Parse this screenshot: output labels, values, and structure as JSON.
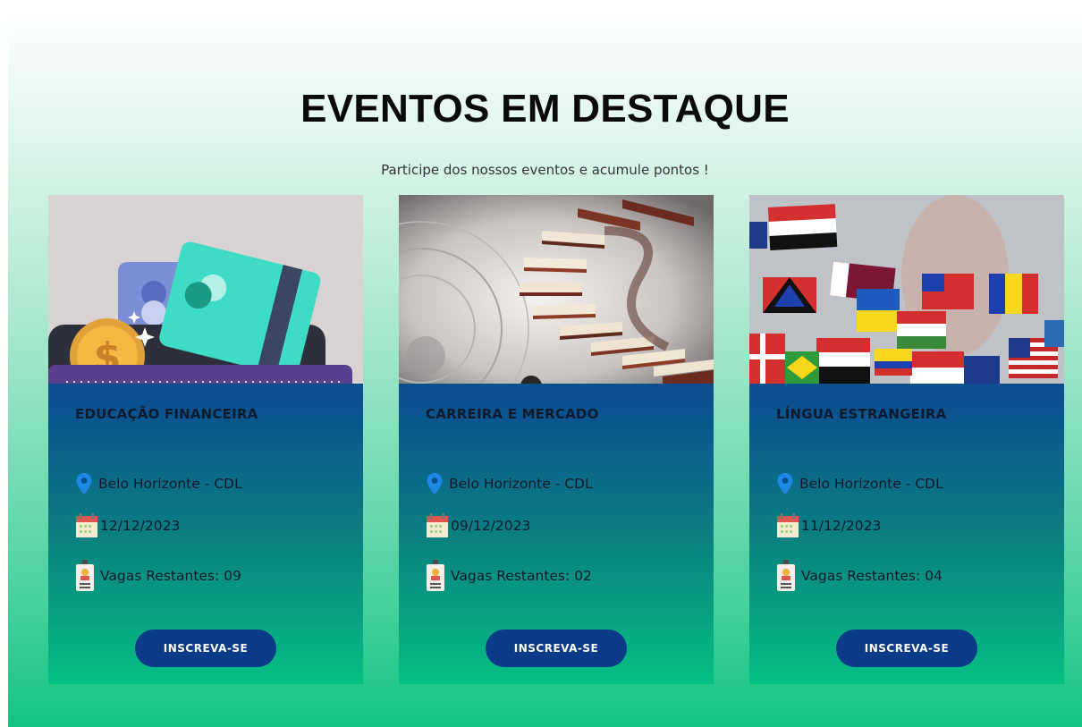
{
  "header": {
    "title": "EVENTOS EM DESTAQUE",
    "subtitle": "Participe dos nossos eventos e acumule pontos !"
  },
  "colors": {
    "card_top": "#0b4f8f",
    "card_bottom": "#05c083",
    "button": "#0a3a88",
    "pin": "#1e88e5"
  },
  "events": [
    {
      "title": "EDUCAÇÃO FINANCEIRA",
      "location": "Belo Horizonte - CDL",
      "date": "12/12/2023",
      "spots": "Vagas Restantes: 09",
      "button_label": "INSCREVA-SE",
      "image": "credit-cards-coin-illustration"
    },
    {
      "title": "CARREIRA E MERCADO",
      "location": "Belo Horizonte - CDL",
      "date": "09/12/2023",
      "spots": "Vagas Restantes: 02",
      "button_label": "INSCREVA-SE",
      "image": "book-spiral-staircase"
    },
    {
      "title": "LÍNGUA ESTRANGEIRA",
      "location": "Belo Horizonte - CDL",
      "date": "11/12/2023",
      "spots": "Vagas Restantes: 04",
      "button_label": "INSCREVA-SE",
      "image": "world-flags"
    }
  ]
}
